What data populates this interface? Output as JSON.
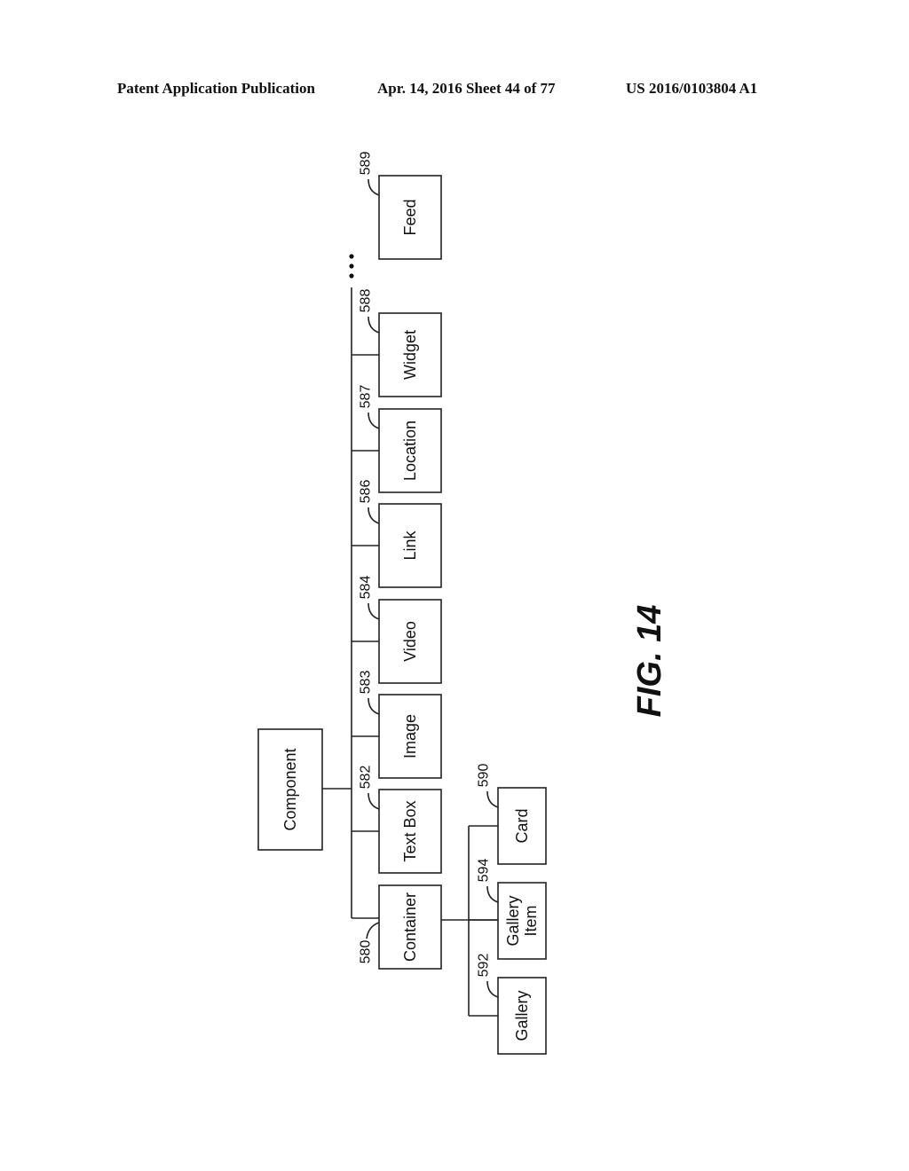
{
  "header": {
    "publication": "Patent Application Publication",
    "date_sheet": "Apr. 14, 2016  Sheet 44 of 77",
    "number": "US 2016/0103804 A1"
  },
  "figure": {
    "label": "FIG. 14",
    "root": {
      "label": "Component"
    },
    "children": [
      {
        "label": "Container",
        "ref": "580"
      },
      {
        "label": "Text Box",
        "ref": "582"
      },
      {
        "label": "Image",
        "ref": "583"
      },
      {
        "label": "Video",
        "ref": "584"
      },
      {
        "label": "Link",
        "ref": "586"
      },
      {
        "label": "Location",
        "ref": "587"
      },
      {
        "label": "Widget",
        "ref": "588"
      },
      {
        "label": "Feed",
        "ref": "589"
      }
    ],
    "container_children": [
      {
        "label": "Gallery",
        "ref": "592"
      },
      {
        "label": "Gallery Item",
        "ref": "594"
      },
      {
        "label": "Card",
        "ref": "590"
      }
    ],
    "ellipsis": "..."
  }
}
